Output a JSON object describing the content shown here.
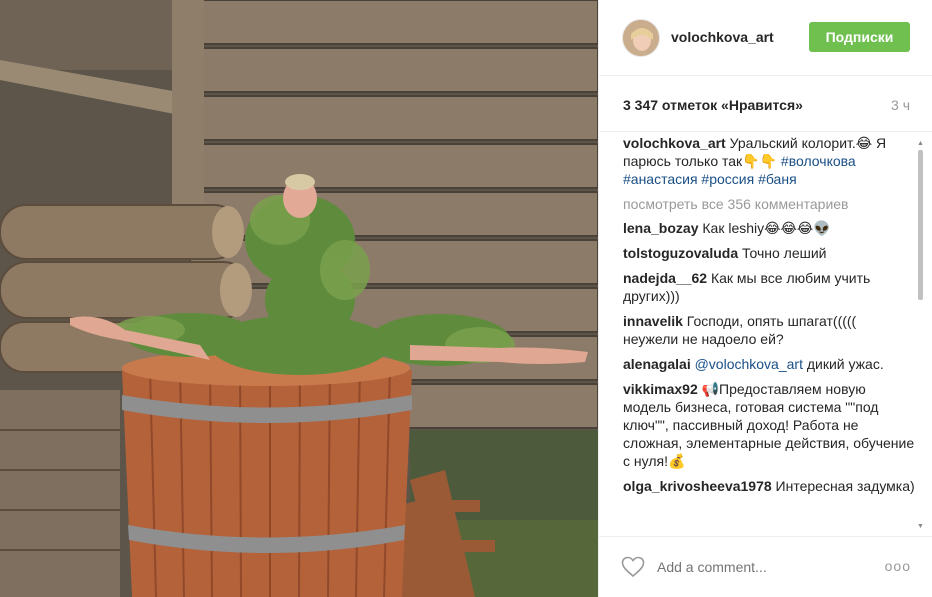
{
  "post": {
    "username": "volochkova_art",
    "follow_label": "Подписки",
    "likes": "3 347 отметок «Нравится»",
    "time": "3 ч",
    "caption": {
      "author": "volochkova_art",
      "text": " Уральский колорит.😂 Я парюсь только так👇👇 ",
      "tags": "#волочкова #анастасия #россия #баня"
    },
    "view_all": "посмотреть все 356 комментариев",
    "comments": [
      {
        "author": "lena_bozay",
        "text": " Как leshiy😂😂😂👽"
      },
      {
        "author": "tolstoguzovaluda",
        "text": " Точно леший"
      },
      {
        "author": "nadejda__62",
        "text": " Как мы все любим учить других)))"
      },
      {
        "author": "innavelik",
        "text": " Господи, опять шпагат((((( неужели не надоело ей?"
      },
      {
        "author": "alenagalai",
        "mention": " @volochkova_art",
        "text": " дикий ужас."
      },
      {
        "author": "vikkimax92",
        "text": " 📢Предоставляем новую модель бизнеса, готовая система \"\"под ключ\"\", пассивный доход! Работа не сложная, элементарные действия, обучение с нуля!💰"
      },
      {
        "author": "olga_krivosheeva1978",
        "text": " Интересная задумка)"
      }
    ],
    "add_comment_placeholder": "Add a comment...",
    "more": "ооо"
  },
  "colors": {
    "follow_green": "#70c050",
    "tag_blue": "#1a4f86",
    "muted": "#999999"
  },
  "icons": [
    "heart-icon",
    "more-icon"
  ]
}
